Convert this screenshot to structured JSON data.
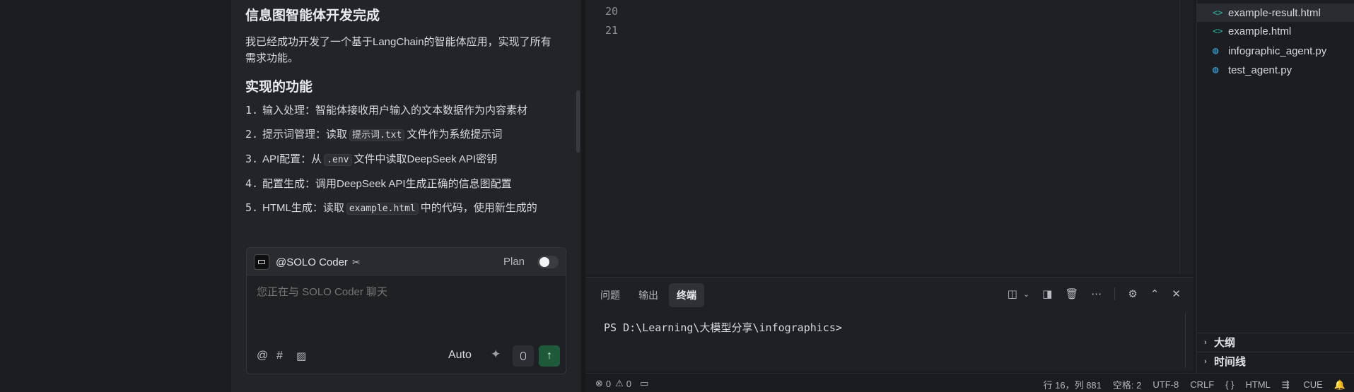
{
  "chat": {
    "title": "信息图智能体开发完成",
    "intro": "我已经成功开发了一个基于LangChain的智能体应用，实现了所有需求功能。",
    "features_heading": "实现的功能",
    "items": [
      {
        "num": "1.",
        "a": "输入处理：智能体接收用户输入的文本数据作为内容素材",
        "code": "",
        "b": ""
      },
      {
        "num": "2.",
        "a": "提示词管理：读取",
        "code": "提示词.txt",
        "b": "文件作为系统提示词"
      },
      {
        "num": "3.",
        "a": "API配置：从",
        "code": ".env",
        "b": "文件中读取DeepSeek API密钥"
      },
      {
        "num": "4.",
        "a": "配置生成：调用DeepSeek API生成正确的信息图配置",
        "code": "",
        "b": ""
      },
      {
        "num": "5.",
        "a": "HTML生成：读取",
        "code": "example.html",
        "b": "中的代码，使用新生成的"
      }
    ]
  },
  "composer": {
    "agent": "@SOLO Coder",
    "plan_label": "Plan",
    "placeholder": "您正在与 SOLO Coder 聊天",
    "mode": "Auto",
    "icons": [
      "at-icon",
      "hash-icon",
      "image-icon",
      "sparkle-icon",
      "mic-icon",
      "send-arrow-icon"
    ]
  },
  "editor": {
    "line_numbers": [
      "20",
      "21"
    ]
  },
  "panel": {
    "tabs": [
      "问题",
      "输出",
      "终端"
    ],
    "active_tab": "终端",
    "terminal_prompt": "PS D:\\Learning\\大模型分享\\infographics>"
  },
  "explorer": {
    "files": [
      {
        "name": "example-result.html",
        "type": "html",
        "selected": true
      },
      {
        "name": "example.html",
        "type": "html",
        "selected": false
      },
      {
        "name": "infographic_agent.py",
        "type": "py",
        "selected": false
      },
      {
        "name": "test_agent.py",
        "type": "py",
        "selected": false
      }
    ],
    "sections": [
      "大纲",
      "时间线"
    ]
  },
  "statusbar": {
    "errors": "0",
    "warnings": "0",
    "position": "行 16，列 881",
    "spaces": "空格: 2",
    "encoding": "UTF-8",
    "eol": "CRLF",
    "braces": "{ }",
    "language": "HTML",
    "cue": "CUE"
  },
  "colors": {
    "background": "#1b1c1f",
    "panel": "#1f2023",
    "send_button": "#1e5a3a",
    "html_icon": "#29b6a6",
    "py_icon": "#3aa0d8"
  }
}
